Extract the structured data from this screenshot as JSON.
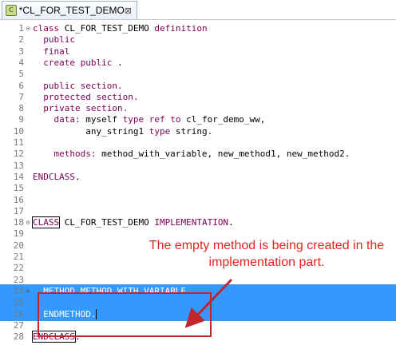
{
  "tab": {
    "title": "*CL_FOR_TEST_DEMO",
    "close_glyph": "⊠",
    "icon": "abap-class-icon"
  },
  "lines": [
    {
      "num": "1",
      "fold": "⊖",
      "tokens": [
        [
          "kw",
          "class "
        ],
        [
          "plain",
          "CL_FOR_TEST_DEMO "
        ],
        [
          "kw",
          "definition"
        ]
      ]
    },
    {
      "num": "2",
      "fold": "",
      "tokens": [
        [
          "kw",
          "  public"
        ]
      ]
    },
    {
      "num": "3",
      "fold": "",
      "tokens": [
        [
          "kw",
          "  final"
        ]
      ]
    },
    {
      "num": "4",
      "fold": "",
      "tokens": [
        [
          "kw",
          "  create public "
        ],
        [
          "plain",
          "."
        ]
      ]
    },
    {
      "num": "5",
      "fold": "",
      "tokens": []
    },
    {
      "num": "6",
      "fold": "",
      "tokens": [
        [
          "kw",
          "  public section."
        ]
      ]
    },
    {
      "num": "7",
      "fold": "",
      "tokens": [
        [
          "kw",
          "  protected section."
        ]
      ]
    },
    {
      "num": "8",
      "fold": "",
      "tokens": [
        [
          "kw",
          "  private section."
        ]
      ]
    },
    {
      "num": "9",
      "fold": "",
      "tokens": [
        [
          "kw",
          "    data: "
        ],
        [
          "plain",
          "myself "
        ],
        [
          "kw",
          "type ref to "
        ],
        [
          "plain",
          "cl_for_demo_ww,"
        ]
      ]
    },
    {
      "num": "10",
      "fold": "",
      "tokens": [
        [
          "plain",
          "          any_string1 "
        ],
        [
          "kw",
          "type "
        ],
        [
          "plain",
          "string."
        ]
      ]
    },
    {
      "num": "11",
      "fold": "",
      "tokens": []
    },
    {
      "num": "12",
      "fold": "",
      "tokens": [
        [
          "kw",
          "    methods: "
        ],
        [
          "plain",
          "method_with_variable, new_method1, new_method2."
        ]
      ]
    },
    {
      "num": "13",
      "fold": "",
      "tokens": []
    },
    {
      "num": "14",
      "fold": "",
      "tokens": [
        [
          "kw",
          "ENDCLASS"
        ],
        [
          "plain",
          "."
        ]
      ]
    },
    {
      "num": "15",
      "fold": "",
      "tokens": []
    },
    {
      "num": "16",
      "fold": "",
      "tokens": []
    },
    {
      "num": "17",
      "fold": "",
      "tokens": []
    },
    {
      "num": "18",
      "fold": "⊖",
      "tokens": [
        [
          "box",
          "CLASS"
        ],
        [
          "plain",
          " CL_FOR_TEST_DEMO "
        ],
        [
          "kw",
          "IMPLEMENTATION"
        ],
        [
          "plain",
          "."
        ]
      ]
    },
    {
      "num": "19",
      "fold": "",
      "tokens": []
    },
    {
      "num": "20",
      "fold": "",
      "tokens": []
    },
    {
      "num": "21",
      "fold": "",
      "tokens": []
    },
    {
      "num": "22",
      "fold": "",
      "tokens": []
    },
    {
      "num": "23",
      "fold": "",
      "tokens": []
    },
    {
      "num": "24",
      "fold": "⊖",
      "hl": true,
      "tokens": [
        [
          "plain",
          "  METHOD METHOD_WITH_VARIABLE."
        ]
      ]
    },
    {
      "num": "25",
      "fold": "",
      "hl": true,
      "tokens": []
    },
    {
      "num": "26",
      "fold": "",
      "hl": true,
      "tokens": [
        [
          "plain",
          "  ENDMETHOD."
        ],
        [
          "cursor",
          ""
        ]
      ]
    },
    {
      "num": "27",
      "fold": "",
      "tokens": []
    },
    {
      "num": "28",
      "fold": "",
      "tokens": [
        [
          "box",
          "ENDCLASS"
        ],
        [
          "plain",
          "."
        ]
      ]
    }
  ],
  "annotation": {
    "text": "The empty method is being created in the implementation part.",
    "color": "#e8231f"
  }
}
